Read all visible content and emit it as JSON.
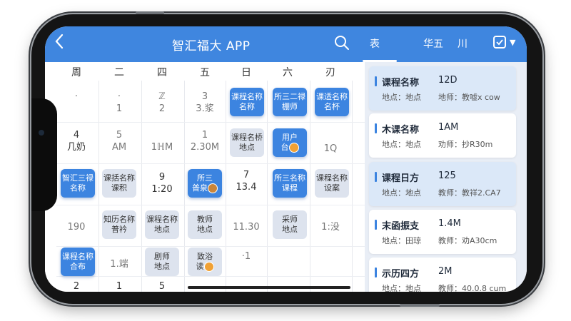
{
  "header": {
    "back_icon": "chevron-left-icon",
    "title": "智汇福大 APP",
    "search_icon": "search-icon",
    "tabs": [
      "表",
      "华五",
      "川"
    ],
    "edit_icon": "edit-square-icon",
    "dropdown_icon": "caret-down-icon"
  },
  "calendar": {
    "weekdays": [
      "周",
      "二",
      "四",
      "五",
      "日",
      "六",
      "刃"
    ],
    "cells": {
      "r1": [
        "·",
        "·\n1",
        "ℤ\n2",
        "3\n3.浆"
      ],
      "r2": [
        "4\n几奶",
        "5\nAM",
        "\n1ℍM",
        "1\n2.30M",
        "",
        "",
        "1Q"
      ],
      "r3": [
        "",
        "",
        "9\n1:20",
        "",
        "7\n13.4",
        "",
        ""
      ],
      "r4": [
        "190",
        "",
        "",
        "",
        "11.30",
        "",
        "1:没"
      ],
      "r5": [
        "",
        "1.端",
        "",
        "",
        "·1",
        "",
        ""
      ],
      "r6": [
        "2",
        "1",
        "5"
      ]
    },
    "chips": {
      "c1": "课程名称\n名称",
      "c2": "所三二禄\n棚师",
      "c3": "课适名称\n名杯",
      "c4": "课程名桥\n地点",
      "c5": "用户\n台",
      "c6": "智汇三禄\n名称",
      "c7": "课括名称\n课积",
      "c8": "所三\n普泉",
      "c9": "所三名称\n课程",
      "c10": "课程名称\n设案",
      "c11": "知历名称\n普衿",
      "c12": "课程名称\n地点",
      "c13": "教师\n地点",
      "c14": "采师\n地点",
      "c15": "课程名称\n合布",
      "c16": "剧师\n地点",
      "c17": "致浴\n读"
    }
  },
  "courses": [
    {
      "name": "课程名称",
      "code": "12D",
      "location": "地点：地点",
      "teacher": "地师：教嘘x cow"
    },
    {
      "name": "木课名称",
      "code": "1AM",
      "location": "地点：地点",
      "teacher": "劝师：抄R30m"
    },
    {
      "name": "课程日方",
      "code": "125",
      "location": "地点：地点",
      "teacher": "教师：教祥2.CA7"
    },
    {
      "name": "末函振支",
      "code": "1.4M",
      "location": "地点：田琼",
      "teacher": "教师：劝A30cm"
    },
    {
      "name": "示历四方",
      "code": "2M",
      "location": "地点：地点",
      "teacher": "教师：40.0.8 cum"
    }
  ],
  "colors": {
    "primary": "#3f86df",
    "chip": "#3c84e0",
    "chip_light": "#dde3ee",
    "panel_bg": "#e9eef6",
    "selected_card": "#dbe8f8"
  }
}
